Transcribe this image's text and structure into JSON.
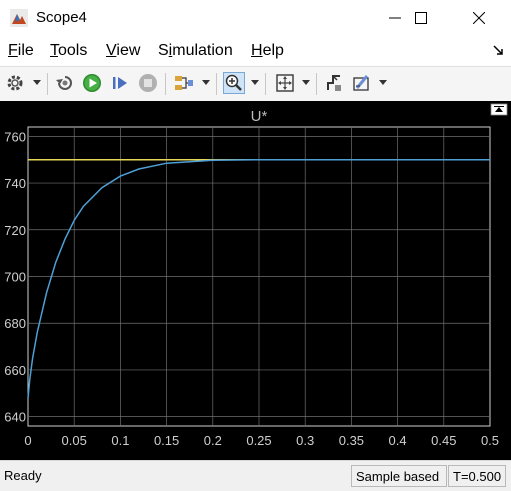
{
  "window": {
    "title": "Scope4",
    "minimize_glyph": "—",
    "maximize_glyph": "☐",
    "close_glyph": "✕"
  },
  "menu": [
    {
      "pre": "",
      "ul": "F",
      "post": "ile"
    },
    {
      "pre": "",
      "ul": "T",
      "post": "ools"
    },
    {
      "pre": "",
      "ul": "V",
      "post": "iew"
    },
    {
      "pre": "S",
      "ul": "i",
      "post": "mulation"
    },
    {
      "pre": "",
      "ul": "H",
      "post": "elp"
    }
  ],
  "toolbar": {
    "icons": [
      "gear-icon",
      "restore-icon",
      "run-icon",
      "step-forward-icon",
      "stop-icon",
      "signal-select-icon",
      "zoom-in-icon",
      "autoscale-icon",
      "triggers-icon",
      "cursor-measure-icon"
    ],
    "zoom_pressed": true
  },
  "chart_data": {
    "type": "line",
    "title": "U*",
    "xlabel": "",
    "ylabel": "",
    "xlim": [
      0,
      0.5
    ],
    "ylim": [
      636,
      764
    ],
    "xticks": [
      "0",
      "0.05",
      "0.1",
      "0.15",
      "0.2",
      "0.25",
      "0.3",
      "0.35",
      "0.4",
      "0.45",
      "0.5"
    ],
    "yticks": [
      "640",
      "660",
      "680",
      "700",
      "720",
      "740",
      "760"
    ],
    "grid": true,
    "background": "#000000",
    "series": [
      {
        "color": "#e8d858",
        "x": [
          0,
          0.25
        ],
        "y": [
          750,
          750
        ]
      },
      {
        "color": "#4d9fd6",
        "x": [
          0,
          0.002,
          0.005,
          0.01,
          0.02,
          0.03,
          0.04,
          0.05,
          0.06,
          0.08,
          0.1,
          0.12,
          0.15,
          0.2,
          0.25,
          0.3,
          0.35,
          0.4,
          0.45,
          0.5
        ],
        "y": [
          648,
          656,
          665,
          676,
          693,
          706,
          716,
          724,
          730,
          738,
          743,
          746,
          748.5,
          749.8,
          750,
          750,
          750,
          750,
          750,
          750
        ]
      }
    ]
  },
  "status": {
    "ready": "Ready",
    "sample": "Sample based",
    "time": "T=0.500"
  }
}
